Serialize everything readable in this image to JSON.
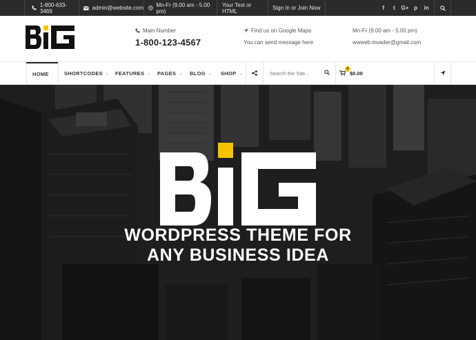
{
  "topbar": {
    "phone": "1-800-633-3469",
    "email": "admin@website.com",
    "hours": "Mn-Fr (9.00 am - 5.00 pm)",
    "custom_text": "Your Text or HTML",
    "signin": "Sign In or Join Now",
    "social": [
      {
        "icon": "facebook-icon",
        "glyph": "f"
      },
      {
        "icon": "twitter-icon",
        "glyph": "t"
      },
      {
        "icon": "google-plus-icon",
        "glyph": "G+"
      },
      {
        "icon": "pinterest-icon",
        "glyph": "p"
      },
      {
        "icon": "linkedin-icon",
        "glyph": "in"
      }
    ]
  },
  "header": {
    "logo_text": "BiG",
    "main_number_label": "Main Number",
    "main_number": "1-800-123-4567",
    "maps_label": "Find us on Google Maps",
    "maps_sub": "You can send message here",
    "hours": "Mn-Fr (9.00 am - 5.00 pm)",
    "email": "wwweb.invader@gmail.com"
  },
  "nav": {
    "items": [
      {
        "label": "HOME",
        "active": true
      },
      {
        "label": "SHORTCODES"
      },
      {
        "label": "FEATURES"
      },
      {
        "label": "PAGES"
      },
      {
        "label": "BLOG"
      },
      {
        "label": "SHOP"
      }
    ],
    "search_placeholder": "Search the Site...",
    "cart_count": "0",
    "cart_amount": "$0.00"
  },
  "hero": {
    "logo_text": "BiG",
    "line1": "WORDPRESS THEME FOR",
    "line2": "ANY BUSINESS IDEA"
  },
  "colors": {
    "accent": "#f5c400",
    "topbar_bg": "#2b2b2b",
    "hero_bg": "#1f1f1f"
  }
}
